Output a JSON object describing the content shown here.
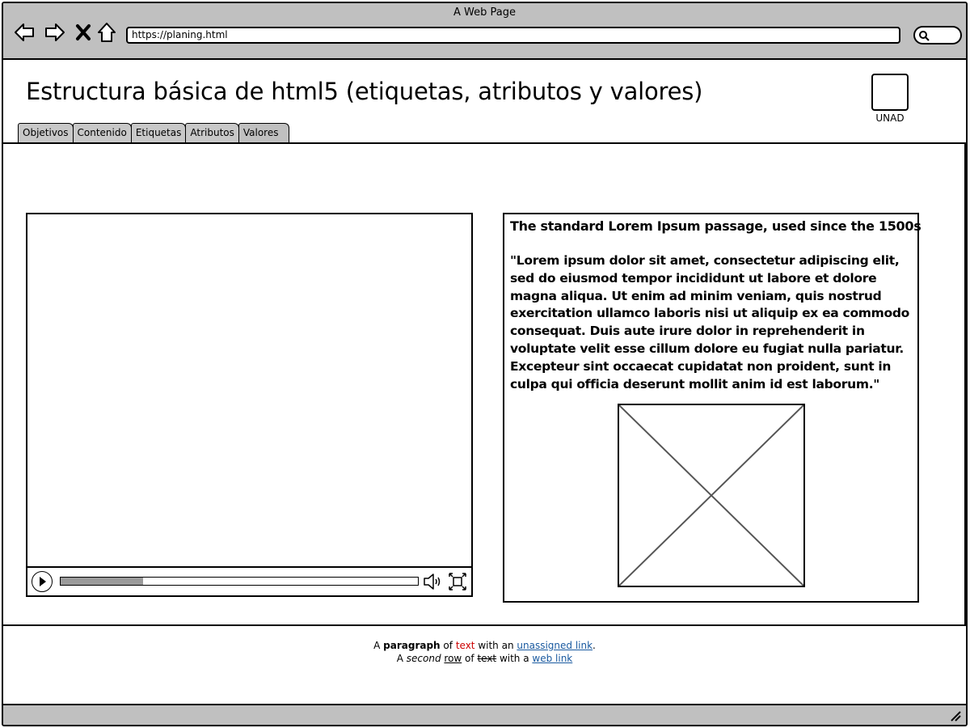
{
  "browser": {
    "window_title": "A Web Page",
    "url": "https://planing.html",
    "icons": [
      "back-icon",
      "forward-icon",
      "stop-icon",
      "home-icon",
      "search-icon"
    ]
  },
  "header": {
    "title": "Estructura básica de html5 (etiquetas, atributos y valores)",
    "logo_label": "UNAD"
  },
  "tabs": [
    {
      "label": "Objetivos"
    },
    {
      "label": "Contenido"
    },
    {
      "label": "Etiquetas"
    },
    {
      "label": "Atributos"
    },
    {
      "label": "Valores"
    }
  ],
  "video": {
    "progress": 0.23,
    "icons": [
      "play-icon",
      "volume-icon",
      "fullscreen-icon"
    ]
  },
  "article": {
    "heading": "The standard Lorem Ipsum passage, used since the 1500s",
    "body": "\"Lorem ipsum dolor sit amet, consectetur adipiscing elit, sed do eiusmod tempor incididunt ut labore et dolore magna aliqua. Ut enim ad minim veniam, quis nostrud exercitation ullamco laboris nisi ut aliquip ex ea commodo consequat. Duis aute irure dolor in reprehenderit in voluptate velit esse cillum dolore eu fugiat nulla pariatur. Excepteur sint occaecat cupidatat non proident, sunt in culpa qui officia deserunt mollit anim id est laborum.\""
  },
  "footer": {
    "line1": {
      "a": "A ",
      "bold": "paragraph",
      "of": " of ",
      "red": "text",
      "with": " with an ",
      "link": "unassigned link",
      "end": "."
    },
    "line2": {
      "a": "A ",
      "italic": "second",
      "space": " ",
      "underline": "row",
      "of": " of ",
      "strike": "text",
      "with": " with a ",
      "link": "web link"
    }
  },
  "colors": {
    "chrome": "#c0c0c0",
    "tab": "#c8c8c8",
    "link": "#1a5aa0",
    "red_text": "#cc0000",
    "progress_fill": "#9a9a9a"
  }
}
